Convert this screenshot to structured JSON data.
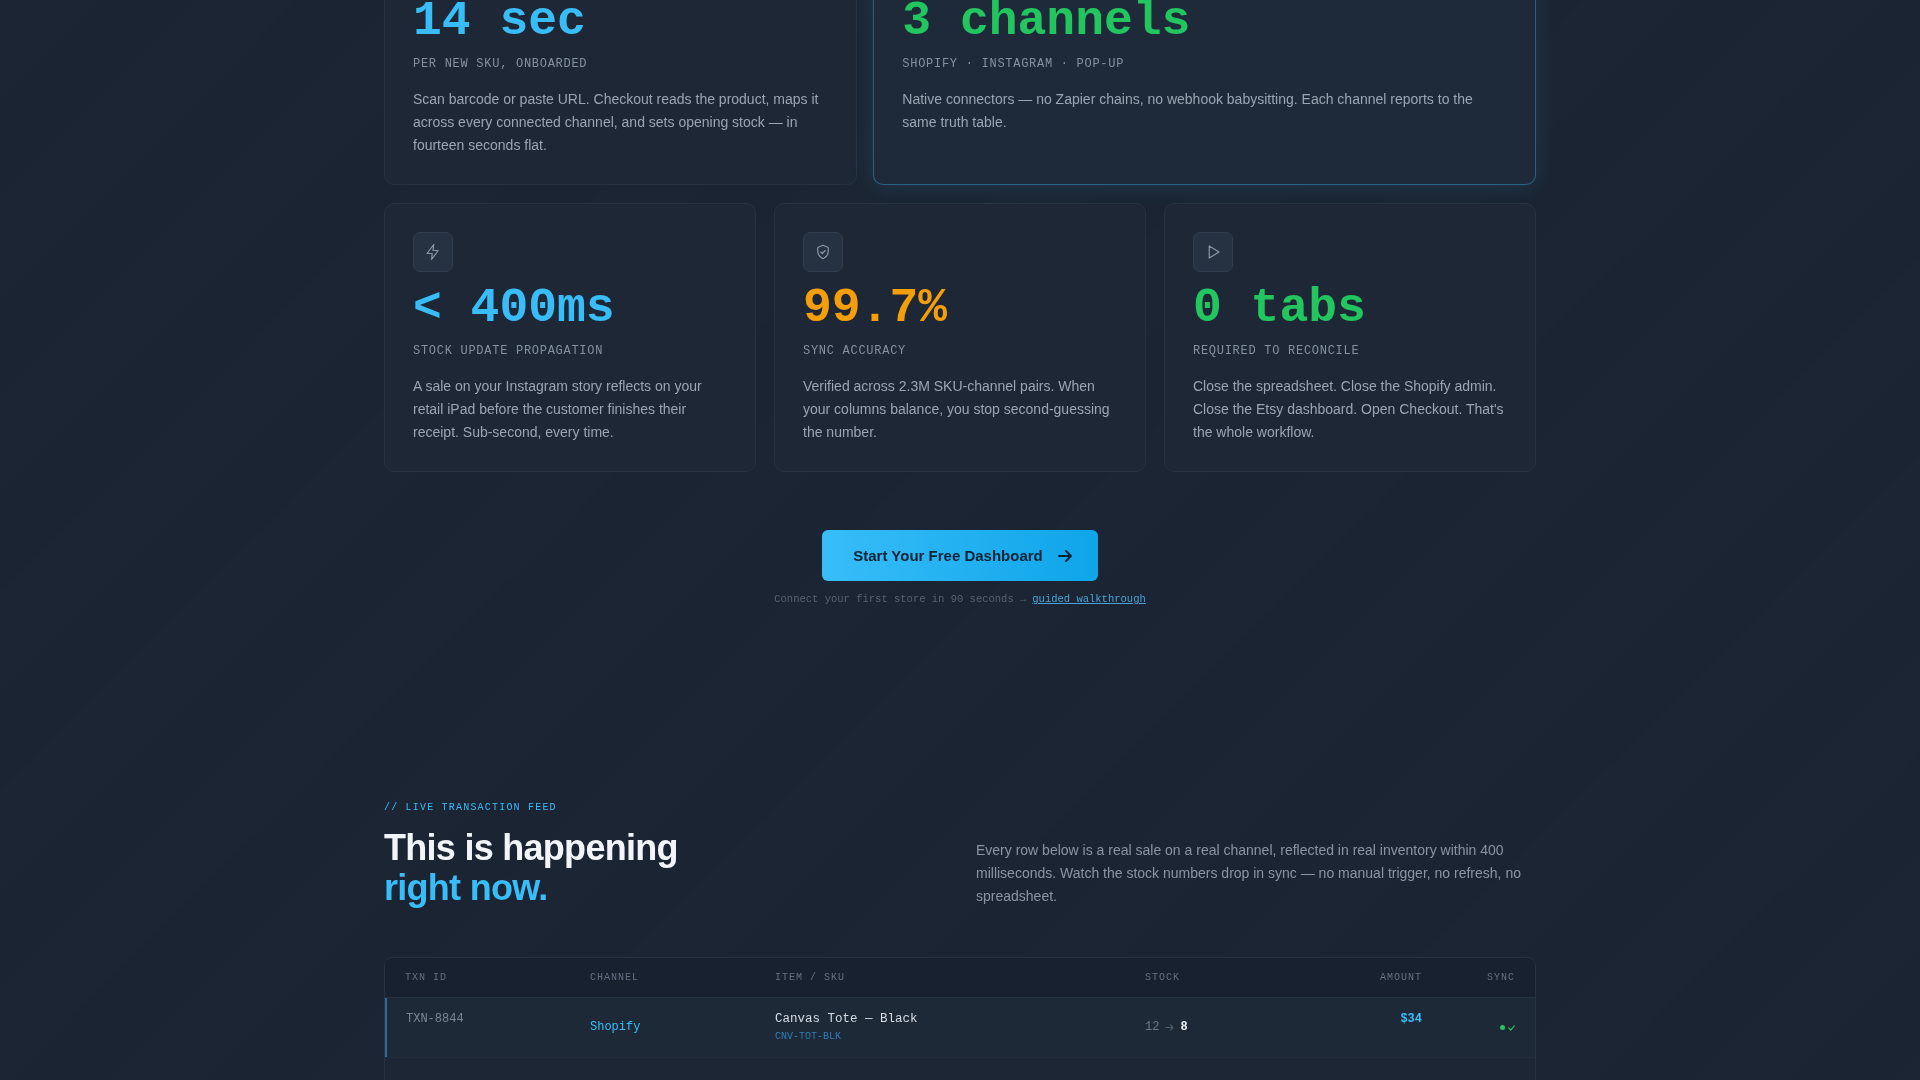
{
  "headline_cards": [
    {
      "value": "14 sec",
      "color": "#38bdf8",
      "label": "PER NEW SKU, ONBOARDED",
      "description": "Scan barcode or paste URL. Checkout reads the product, maps it across every connected channel, and sets opening stock — in fourteen seconds flat.",
      "featured": false
    },
    {
      "value": "3 channels",
      "color": "#22c55e",
      "label": "SHOPIFY · INSTAGRAM · POP-UP",
      "description": "Native connectors — no Zapier chains, no webhook babysitting. Each channel reports to the same truth table.",
      "featured": true
    }
  ],
  "metric_cards": [
    {
      "value": "< 400ms",
      "color": "#38bdf8",
      "label": "STOCK UPDATE PROPAGATION",
      "description": "A sale on your Instagram story reflects on your retail iPad before the customer finishes their receipt. Sub-second, every time."
    },
    {
      "value": "99.7%",
      "color": "#f59e0b",
      "label": "SYNC ACCURACY",
      "description": "Verified across 2.3M SKU-channel pairs. When your columns balance, you stop second-guessing the number."
    },
    {
      "value": "0 tabs",
      "color": "#22c55e",
      "label": "REQUIRED TO RECONCILE",
      "description": "Close the spreadsheet. Close the Shopify admin. Close the Etsy dashboard. Open Checkout. That's the whole workflow."
    }
  ],
  "cta": {
    "button": "Start Your Free Dashboard",
    "note": "Connect your first store in 90 seconds →",
    "link": "guided walkthrough"
  },
  "feed": {
    "eyebrow": "// LIVE TRANSACTION FEED",
    "heading": "This is happening",
    "heading_accent": "right now.",
    "intro": "Every row below is a real sale on a real channel, reflected in real inventory within 400 milliseconds. Watch the stock numbers drop in sync — no manual trigger, no refresh, no spreadsheet.",
    "table": {
      "columns": [
        "TXN ID",
        "CHANNEL",
        "ITEM / SKU",
        "STOCK",
        "AMOUNT",
        "SYNC"
      ],
      "rows": [
        {
          "txn_id": "TXN-8844",
          "channel": "Shopify",
          "item": "Canvas Tote — Black",
          "sku": "CNV-TOT-BLK",
          "stock_from": "12",
          "stock_to": "8",
          "amount": "$34",
          "synced": true,
          "highlighted": true
        }
      ]
    }
  }
}
